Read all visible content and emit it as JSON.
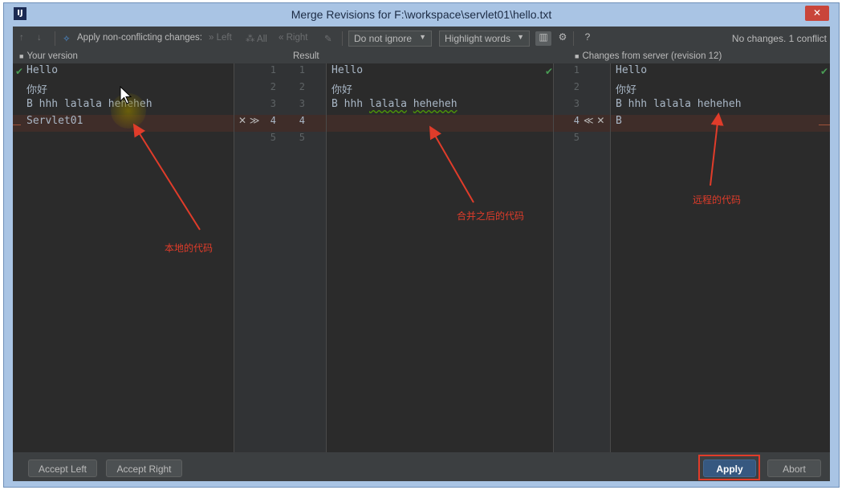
{
  "window": {
    "title": "Merge Revisions for F:\\workspace\\servlet01\\hello.txt",
    "app_icon": "IJ",
    "close_glyph": "✕"
  },
  "toolbar": {
    "prev_glyph": "↑",
    "next_glyph": "↓",
    "apply_glyph": "✧",
    "apply_label": "Apply non-conflicting changes:",
    "left_label": "» Left",
    "all_label": "⁂ All",
    "right_label": "« Right",
    "magic_glyph": "✎",
    "ignore_select": "Do not ignore",
    "highlight_select": "Highlight words",
    "columns_glyph": "▥",
    "settings_glyph": "⚙",
    "help_glyph": "?",
    "status": "No changes. 1 conflict"
  },
  "headers": {
    "left": "Your version",
    "center": "Result",
    "right": "Changes from server (revision 12)",
    "lock_glyph": "🔒"
  },
  "left_lines": [
    "Hello",
    "你好",
    "B hhh lalala heheheh",
    "Servlet01"
  ],
  "center_lines": [
    "Hello",
    "你好",
    "B hhh lalala heheheh",
    ""
  ],
  "center_line3_parts": [
    "B hhh ",
    "lalala",
    " ",
    "heheheh"
  ],
  "right_lines": [
    "Hello",
    "你好",
    "B hhh lalala heheheh",
    "B"
  ],
  "gutter_left": {
    "left_numbers": [
      "1",
      "2",
      "3",
      "4",
      "5"
    ],
    "right_numbers": [
      "1",
      "2",
      "3",
      "4",
      "5"
    ],
    "conflict_actions": "✕ ≫"
  },
  "gutter_right": {
    "numbers": [
      "1",
      "2",
      "3",
      "4",
      "5"
    ],
    "conflict_actions": "≪ ✕"
  },
  "check_glyph": "✔",
  "annotations": {
    "local": "本地的代码",
    "merged": "合并之后的代码",
    "remote": "远程的代码"
  },
  "buttons": {
    "accept_left": "Accept Left",
    "accept_right": "Accept Right",
    "apply": "Apply",
    "abort": "Abort"
  },
  "colors": {
    "conflict": "#3f2d29",
    "annotation": "#e03c2a",
    "primary_button": "#365880"
  }
}
